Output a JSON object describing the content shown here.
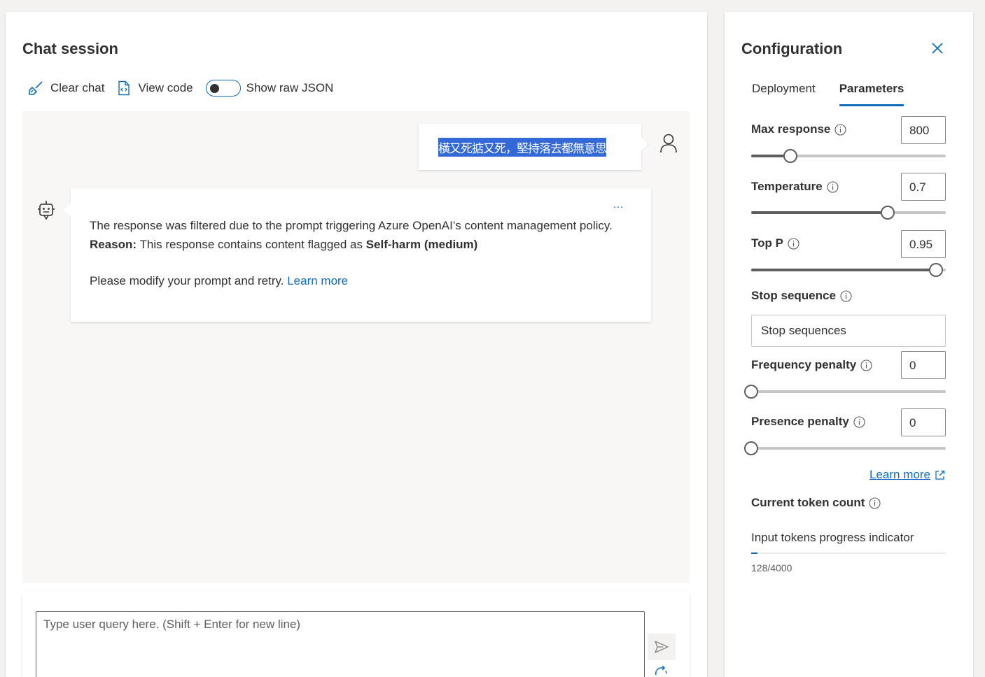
{
  "chat": {
    "title": "Chat session",
    "toolbar": {
      "clear_label": "Clear chat",
      "view_code_label": "View code",
      "raw_json_label": "Show raw JSON",
      "raw_json_on": false
    },
    "user_message": "橫又死掂又死，堅持落去都無意思",
    "bot_message": {
      "line1": "The response was filtered due to the prompt triggering Azure OpenAI’s content management policy.",
      "reason_label": "Reason:",
      "reason_text": " This response contains content flagged as ",
      "reason_category": "Self-harm (medium)",
      "retry_text": "Please modify your prompt and retry. ",
      "learn_more": "Learn more",
      "more_options": "…"
    },
    "input": {
      "placeholder": "Type user query here. (Shift + Enter for new line)",
      "value": ""
    }
  },
  "config": {
    "title": "Configuration",
    "tabs": [
      {
        "label": "Deployment",
        "active": false
      },
      {
        "label": "Parameters",
        "active": true
      }
    ],
    "params": {
      "max_response": {
        "label": "Max response",
        "value": "800",
        "fraction": 0.2
      },
      "temperature": {
        "label": "Temperature",
        "value": "0.7",
        "fraction": 0.7
      },
      "top_p": {
        "label": "Top P",
        "value": "0.95",
        "fraction": 0.95
      },
      "stop_sequence": {
        "label": "Stop sequence",
        "placeholder": "Stop sequences"
      },
      "frequency_penalty": {
        "label": "Frequency penalty",
        "value": "0",
        "fraction": 0
      },
      "presence_penalty": {
        "label": "Presence penalty",
        "value": "0",
        "fraction": 0
      }
    },
    "learn_more": "Learn more",
    "token_count": {
      "title": "Current token count",
      "progress_label": "Input tokens progress indicator",
      "count_text": "128/4000",
      "used": 128,
      "max": 4000
    }
  },
  "colors": {
    "accent": "#0f6cbd",
    "selection": "#3369d6"
  }
}
